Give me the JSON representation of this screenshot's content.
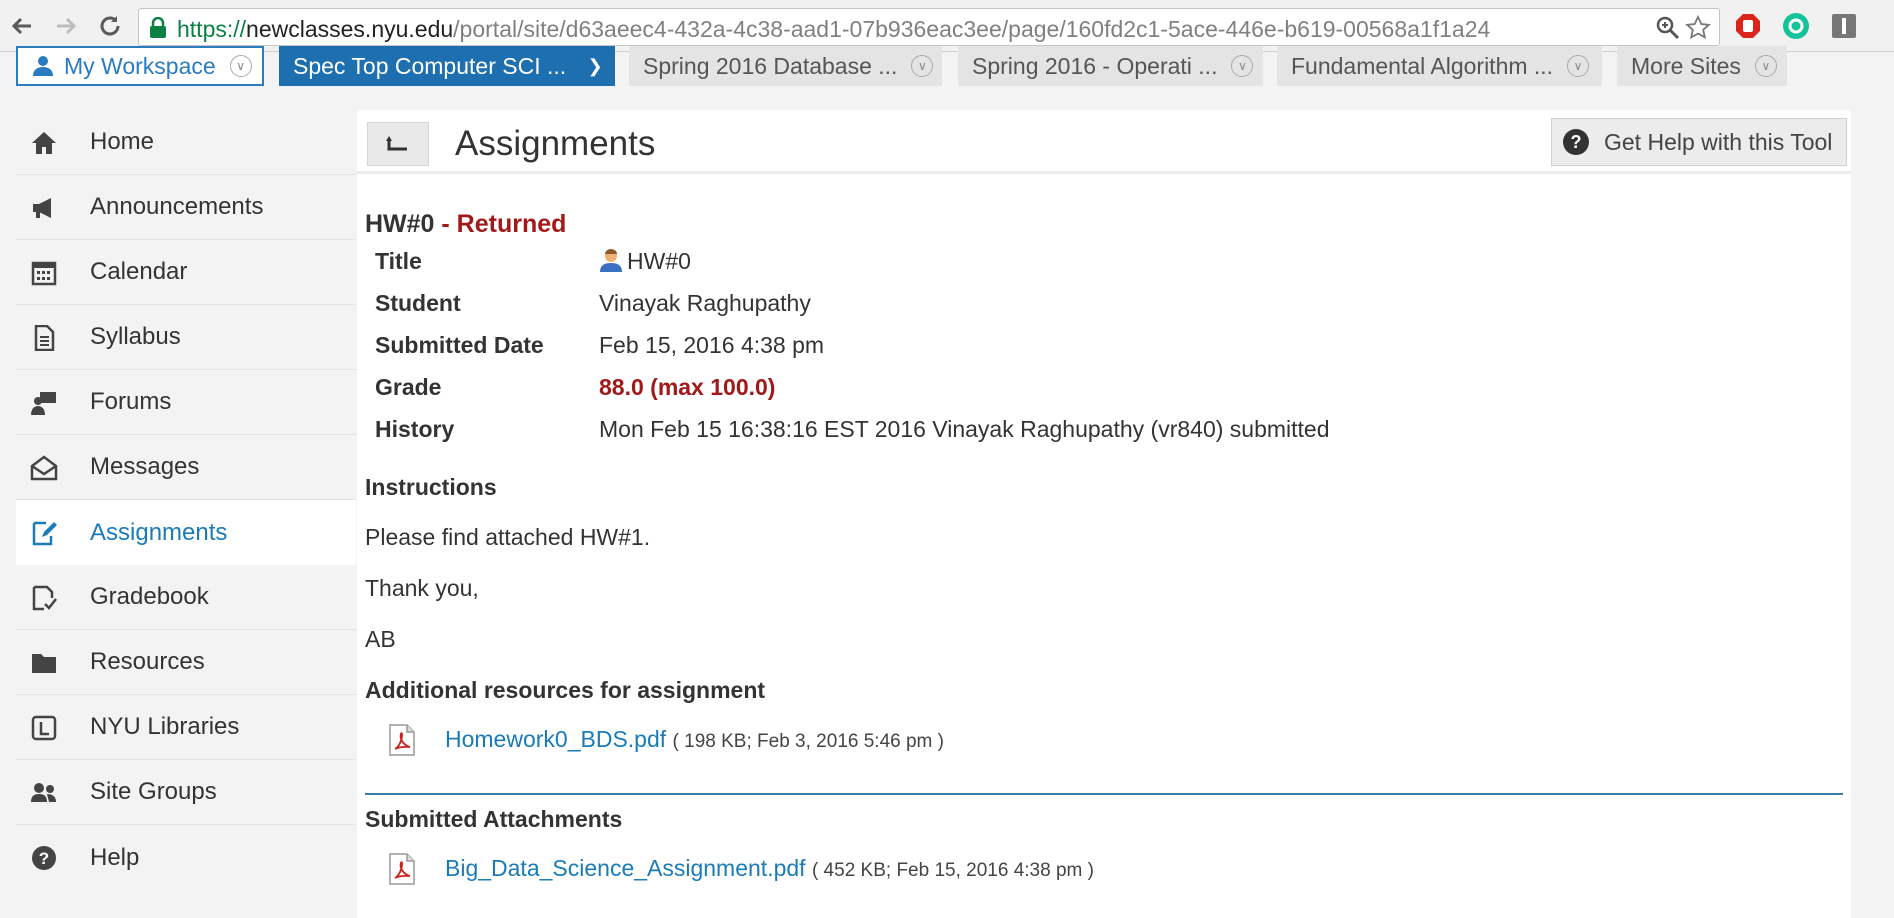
{
  "browser": {
    "url_scheme": "https://",
    "url_host": "newclasses.nyu.edu",
    "url_path": "/portal/site/d63aeec4-432a-4c38-aad1-07b936eac3ee/page/160fd2c1-5ace-446e-b619-00568a1f1a24"
  },
  "sites": [
    {
      "label": "My Workspace"
    },
    {
      "label": "Spec Top Computer SCI ..."
    },
    {
      "label": "Spring 2016 Database ..."
    },
    {
      "label": "Spring 2016 - Operati ..."
    },
    {
      "label": "Fundamental Algorithm ..."
    },
    {
      "label": "More Sites"
    }
  ],
  "nav": [
    {
      "label": "Home",
      "icon": "home-icon"
    },
    {
      "label": "Announcements",
      "icon": "megaphone-icon"
    },
    {
      "label": "Calendar",
      "icon": "calendar-icon"
    },
    {
      "label": "Syllabus",
      "icon": "document-icon"
    },
    {
      "label": "Forums",
      "icon": "forum-icon"
    },
    {
      "label": "Messages",
      "icon": "envelope-icon"
    },
    {
      "label": "Assignments",
      "icon": "edit-icon",
      "active": true
    },
    {
      "label": "Gradebook",
      "icon": "gradebook-icon"
    },
    {
      "label": "Resources",
      "icon": "folder-icon"
    },
    {
      "label": "NYU Libraries",
      "icon": "library-icon"
    },
    {
      "label": "Site Groups",
      "icon": "users-icon"
    },
    {
      "label": "Help",
      "icon": "help-icon"
    }
  ],
  "tool": {
    "title": "Assignments",
    "help_label": "Get Help with this Tool"
  },
  "assignment": {
    "name": "HW#0",
    "status": " - Returned",
    "fields": [
      {
        "key": "Title",
        "value": "HW#0"
      },
      {
        "key": "Student",
        "value": "Vinayak Raghupathy"
      },
      {
        "key": "Submitted Date",
        "value": "Feb 15, 2016 4:38 pm"
      },
      {
        "key": "Grade",
        "value": "88.0 (max 100.0)"
      },
      {
        "key": "History",
        "value": "Mon Feb 15 16:38:16 EST 2016 Vinayak Raghupathy (vr840) submitted"
      }
    ],
    "instructions_heading": "Instructions",
    "instructions": [
      "Please find attached HW#1.",
      "Thank you,",
      "AB"
    ],
    "resources_heading": "Additional resources for assignment",
    "resource_file": {
      "name": "Homework0_BDS.pdf",
      "meta": "( 198 KB; Feb 3, 2016 5:46 pm )"
    },
    "submitted_heading": "Submitted Attachments",
    "submitted_file": {
      "name": "Big_Data_Science_Assignment.pdf",
      "meta": "( 452 KB; Feb 15, 2016 4:38 pm )"
    }
  },
  "colors": {
    "accent": "#1a7bb9",
    "returned": "#a11a1a",
    "active_site": "#1d6fb0"
  }
}
